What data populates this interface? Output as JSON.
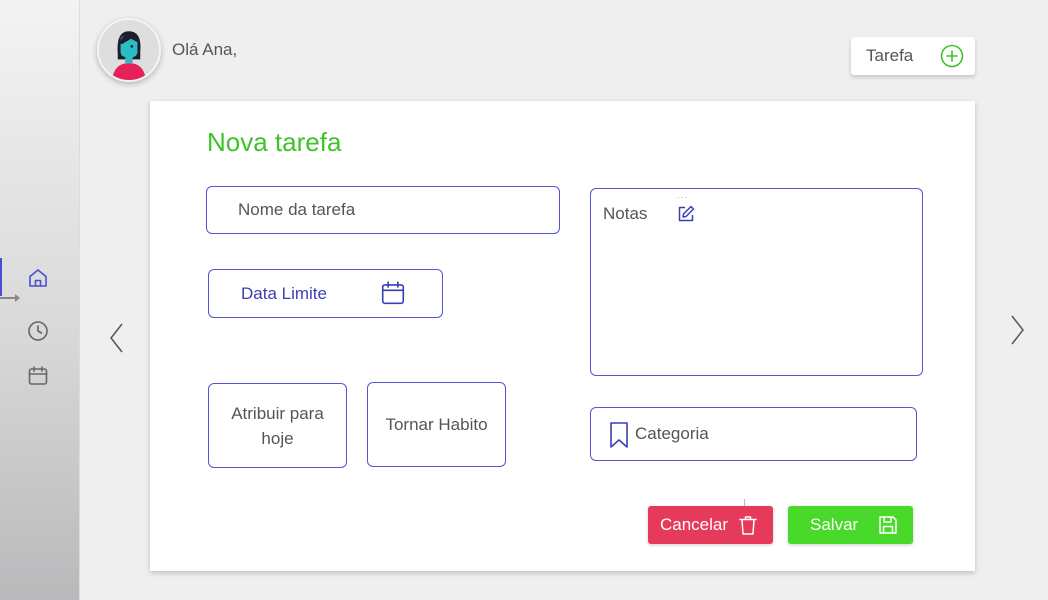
{
  "user": {
    "greeting": "Olá Ana,"
  },
  "header": {
    "new_task_label": "Tarefa"
  },
  "sidebar": {
    "items": [
      {
        "name": "home",
        "icon": "home-icon",
        "active": true
      },
      {
        "name": "history",
        "icon": "clock-icon"
      },
      {
        "name": "calendar",
        "icon": "calendar-icon"
      }
    ]
  },
  "form": {
    "title": "Nova tarefa",
    "task_name_placeholder": "Nome da tarefa",
    "due_date_label": "Data Limite",
    "assign_today_label": "Atribuir para hoje",
    "make_habit_label": "Tornar Habito",
    "notes_label": "Notas",
    "category_label": "Categoria",
    "cancel_label": "Cancelar",
    "save_label": "Salvar"
  },
  "colors": {
    "accent_green": "#3fc22a",
    "border_blue": "#5257d6",
    "cancel_red": "#e63a5a",
    "save_green": "#49d92a"
  }
}
